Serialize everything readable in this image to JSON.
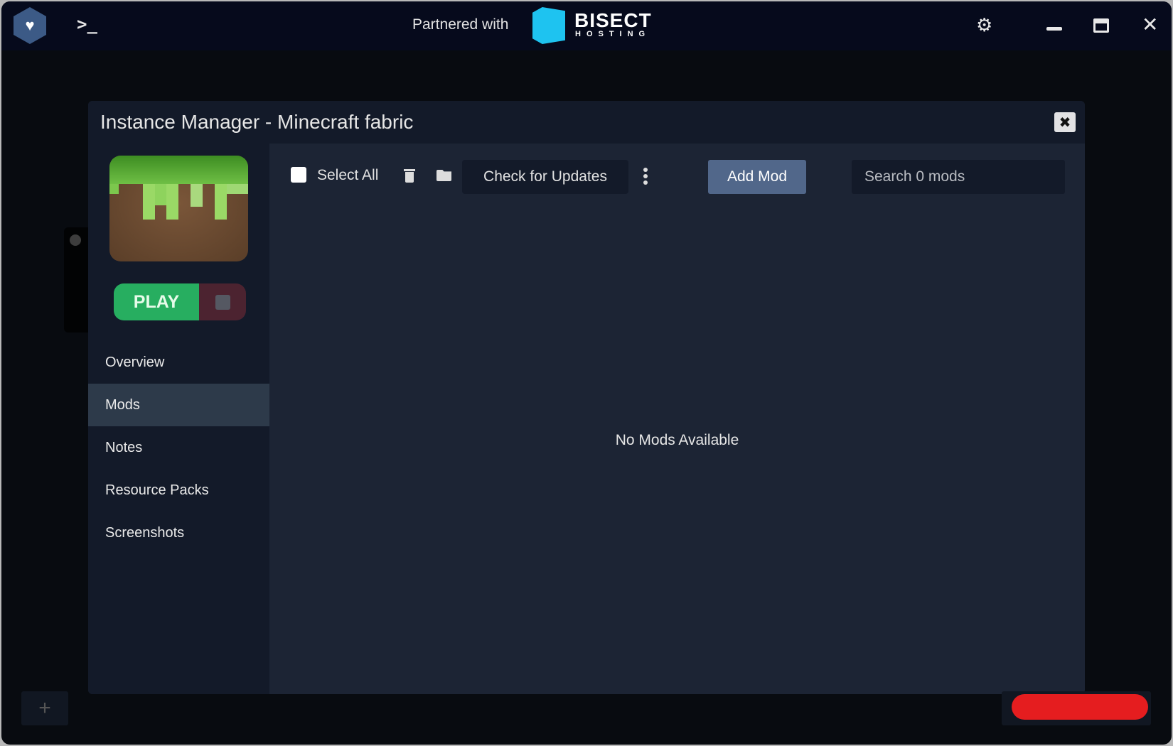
{
  "titlebar": {
    "terminal_icon": ">_",
    "partner_label": "Partnered with",
    "partner_brand": "BISECT",
    "partner_brand_sub": "HOSTING",
    "icons": [
      "app-logo-icon",
      "terminal-icon",
      "settings-icon",
      "minimize-icon",
      "maximize-icon",
      "close-icon"
    ]
  },
  "modal": {
    "title": "Instance Manager - Minecraft fabric",
    "close_icon": "✖",
    "play_label": "PLAY",
    "nav": [
      {
        "label": "Overview",
        "active": false
      },
      {
        "label": "Mods",
        "active": true
      },
      {
        "label": "Notes",
        "active": false
      },
      {
        "label": "Resource Packs",
        "active": false
      },
      {
        "label": "Screenshots",
        "active": false
      }
    ],
    "toolbar": {
      "select_all": "Select All",
      "check_updates": "Check for Updates",
      "add_mod": "Add Mod",
      "search_placeholder": "Search 0 mods"
    },
    "empty_message": "No Mods Available"
  },
  "footer": {
    "add_icon": "+"
  },
  "colors": {
    "accent": "#51678a",
    "play": "#27ae60",
    "stop": "#4c2330",
    "alert": "#e51d1f",
    "brand": "#1ec3f0"
  }
}
